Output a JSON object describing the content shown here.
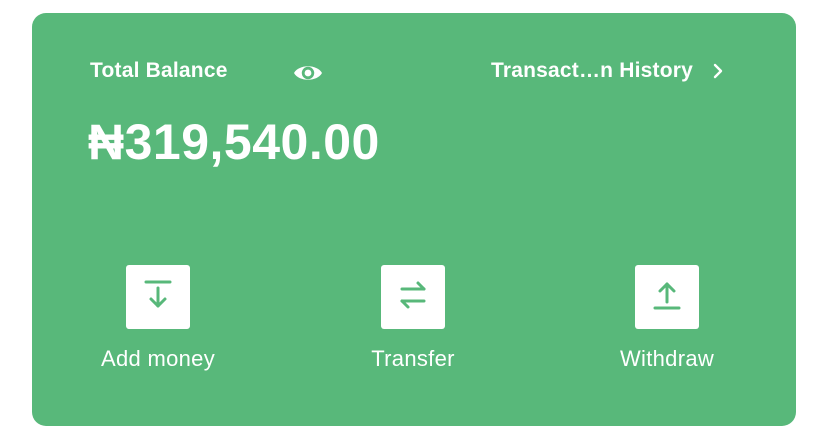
{
  "wallet": {
    "balance_label": "Total Balance",
    "balance_amount": "₦319,540.00",
    "history_link": "Transact…n History",
    "icons": {
      "visibility": "eye-icon",
      "history": "chevron-right-icon"
    }
  },
  "actions": [
    {
      "label": "Add money",
      "icon": "download-arrow-icon"
    },
    {
      "label": "Transfer",
      "icon": "swap-arrows-icon"
    },
    {
      "label": "Withdraw",
      "icon": "upload-arrow-icon"
    }
  ],
  "colors": {
    "card_background": "#58b87a",
    "text": "#ffffff",
    "icon_tile": "#ffffff",
    "icon_stroke": "#58b87a"
  }
}
